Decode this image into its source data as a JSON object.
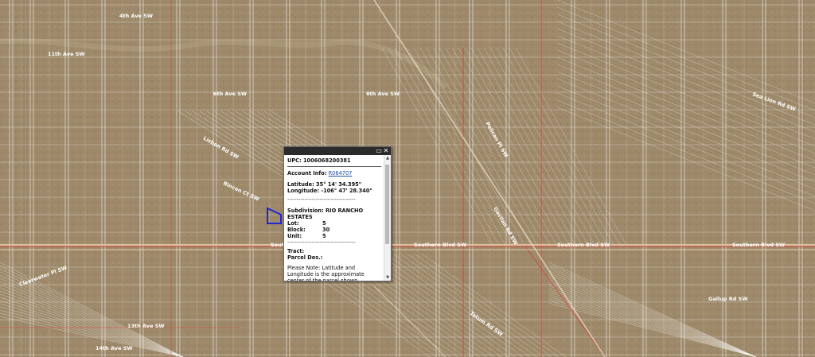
{
  "map": {
    "street_labels": [
      "4th Ave SW",
      "6th Ave SW",
      "8th Ave SW",
      "Lisbon Rd SW",
      "Rincon Ct SW",
      "Southern Blvd SW",
      "Southern Blvd SW",
      "Southern Blvd SW",
      "Southern Blvd SW",
      "Clearwater Pl SW",
      "Gallup Rd SW",
      "13th Ave SW",
      "14th Ave SW",
      "11th Ave SW",
      "Sea Lion Rd SW",
      "Pelican Pl SW",
      "Gavilan Rd SW",
      "Tatum Rd SW"
    ]
  },
  "popup": {
    "maximize_icon": "maximize-icon",
    "close_icon": "close-icon",
    "upc_label": "UPC:",
    "upc_value": "1006068200381",
    "account_label": "Account Info:",
    "account_value": "R064707",
    "latitude_label": "Latitude:",
    "latitude_value": "35° 14' 34.395\"",
    "longitude_label": "Longitude:",
    "longitude_value": "-106° 47' 28.340\"",
    "dash_line": "------------------------------------",
    "subdivision_label": "Subdivision:",
    "subdivision_value": "RIO RANCHO ESTATES",
    "lot_label": "Lot:",
    "lot_value": "5",
    "block_label": "Block:",
    "block_value": "30",
    "unit_label": "Unit:",
    "unit_value": "5",
    "tract_label": "Tract:",
    "parcel_label": "Parcel Des.:",
    "note": "Please Note: Latitude and Longitude is the approximate center of the parcel shown."
  },
  "colors": {
    "terrain": "#9c8768",
    "parcel_line": "#ffffff",
    "boundary_line": "#d83a2e",
    "selected_parcel": "#2424d8",
    "popup_titlebar": "#2b2b2b"
  }
}
